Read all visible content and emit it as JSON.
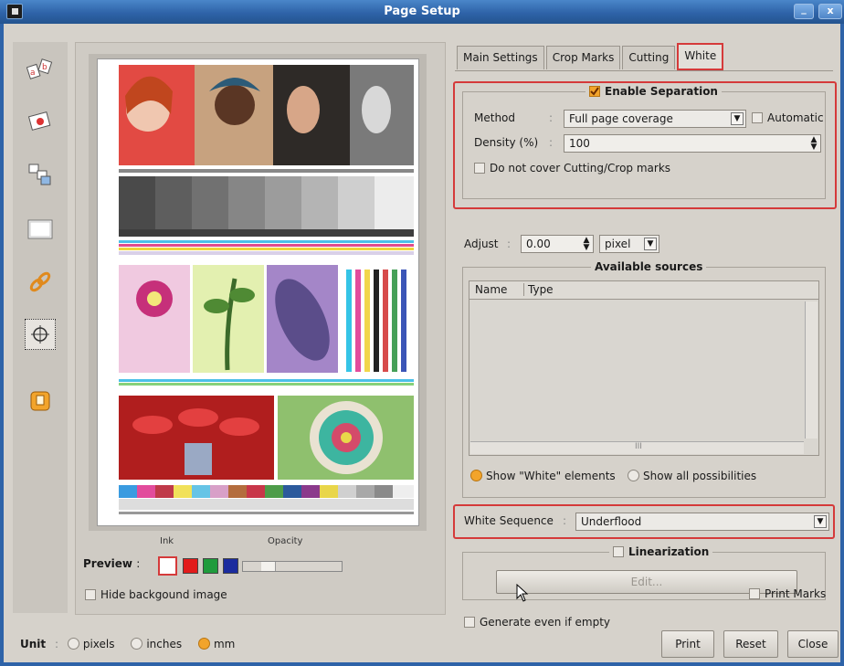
{
  "window": {
    "title": "Page Setup",
    "minimize_glyph": "_",
    "close_glyph": "x"
  },
  "sidebar": {
    "icons": [
      "text-order-icon",
      "rotate-icon",
      "layers-icon",
      "page-icon",
      "link-icon",
      "target-icon",
      "badge-icon"
    ]
  },
  "preview": {
    "ink_label": "Ink",
    "opacity_label": "Opacity",
    "preview_label": "Preview",
    "preview_sep": ":",
    "hide_background_label": "Hide backgound image",
    "ink_colors": [
      "#ffffff",
      "#e21b1b",
      "#1f9b3c",
      "#1b2b9e"
    ]
  },
  "tabs": [
    "Main Settings",
    "Crop Marks",
    "Cutting",
    "White"
  ],
  "active_tab": "White",
  "separation": {
    "enable_label": "Enable Separation",
    "enabled": true,
    "method_label": "Method",
    "method_value": "Full page coverage",
    "automatic_label": "Automatic",
    "density_label": "Density (%)",
    "density_value": "100",
    "no_cover_label": "Do not cover Cutting/Crop marks"
  },
  "adjust": {
    "label": "Adjust",
    "value": "0.00",
    "unit": "pixel"
  },
  "sources": {
    "title": "Available sources",
    "col_name": "Name",
    "col_type": "Type",
    "scroll_marker": "III",
    "show_white_label": "Show \"White\" elements",
    "show_all_label": "Show all possibilities"
  },
  "white_sequence": {
    "label": "White Sequence",
    "value": "Underflood"
  },
  "linearization": {
    "label": "Linearization",
    "edit_label": "Edit..."
  },
  "bottom_options": {
    "generate_label": "Generate even if empty",
    "print_marks_label": "Print Marks"
  },
  "unit": {
    "label": "Unit",
    "options": [
      "pixels",
      "inches",
      "mm"
    ],
    "selected": "mm"
  },
  "buttons": {
    "print": "Print",
    "reset": "Reset",
    "close": "Close"
  },
  "colors": {
    "title_bar": "#2e63a8",
    "highlight_red": "#d53a3a",
    "accent_orange": "#f2a42b"
  }
}
